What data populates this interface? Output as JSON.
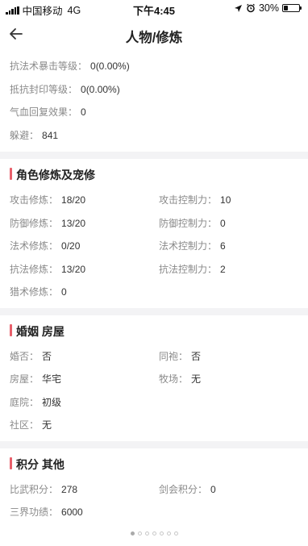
{
  "status": {
    "carrier": "中国移动",
    "network": "4G",
    "time": "下午4:45",
    "battery": "30%",
    "battery_level": 0.3
  },
  "nav": {
    "title": "人物/修炼",
    "back_icon": "arrow-left-icon"
  },
  "top_stats": [
    {
      "label": "抗法术暴击等级：",
      "value": "0(0.00%)"
    },
    {
      "label": "抵抗封印等级：",
      "value": "0(0.00%)"
    },
    {
      "label": "气血回复效果：",
      "value": "0"
    },
    {
      "label": "躲避：",
      "value": "841"
    }
  ],
  "cultivation": {
    "title": "角色修炼及宠修",
    "rows": [
      {
        "left_label": "攻击修炼：",
        "left_value": "18/20",
        "right_label": "攻击控制力：",
        "right_value": "10"
      },
      {
        "left_label": "防御修炼：",
        "left_value": "13/20",
        "right_label": "防御控制力：",
        "right_value": "0"
      },
      {
        "left_label": "法术修炼：",
        "left_value": "0/20",
        "right_label": "法术控制力：",
        "right_value": "6"
      },
      {
        "left_label": "抗法修炼：",
        "left_value": "13/20",
        "right_label": "抗法控制力：",
        "right_value": "2"
      },
      {
        "left_label": "猎术修炼：",
        "left_value": "0"
      }
    ]
  },
  "marriage": {
    "title": "婚姻 房屋",
    "rows": [
      {
        "left_label": "婚否：",
        "left_value": "否",
        "right_label": "同袍：",
        "right_value": "否"
      },
      {
        "left_label": "房屋：",
        "left_value": "华宅",
        "right_label": "牧场：",
        "right_value": "无"
      },
      {
        "left_label": "庭院：",
        "left_value": "初级"
      },
      {
        "left_label": "社区：",
        "left_value": "无"
      }
    ]
  },
  "points": {
    "title": "积分 其他",
    "rows": [
      {
        "left_label": "比武积分：",
        "left_value": "278",
        "right_label": "剑会积分：",
        "right_value": "0"
      },
      {
        "left_label": "三界功绩：",
        "left_value": "6000"
      }
    ]
  },
  "pager": {
    "total": 7,
    "active": 0
  },
  "colors": {
    "accent": "#e8606b",
    "separator": "#f3f3f5",
    "label": "#8a8a8a"
  }
}
